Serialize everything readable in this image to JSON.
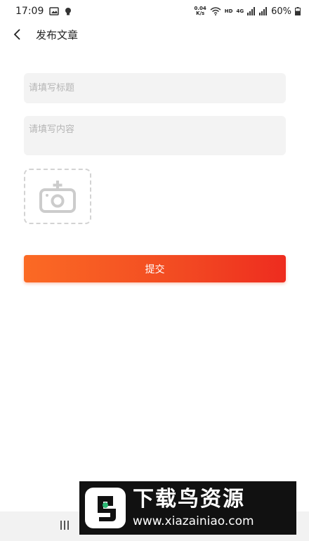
{
  "status_bar": {
    "time": "17:09",
    "net_speed_value": "0.04",
    "net_speed_unit": "K/s",
    "hd_label": "HD",
    "network_label": "4G",
    "battery_percent": "60%"
  },
  "header": {
    "title": "发布文章"
  },
  "form": {
    "title_placeholder": "请填写标题",
    "content_placeholder": "请填写内容",
    "submit_label": "提交"
  },
  "watermark": {
    "title": "下载鸟资源",
    "url": "www.xiazainiao.com"
  },
  "colors": {
    "accent_start": "#fb6a24",
    "accent_end": "#ee2c1f"
  }
}
